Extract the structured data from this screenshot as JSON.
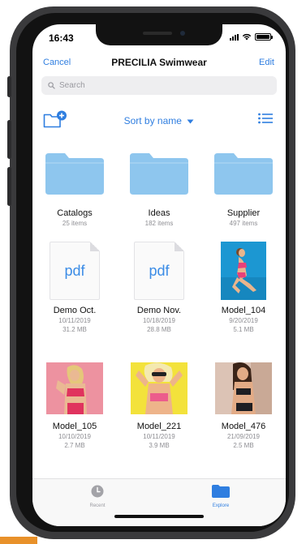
{
  "status": {
    "time": "16:43"
  },
  "nav": {
    "cancel": "Cancel",
    "title": "PRECILIA Swimwear",
    "edit": "Edit"
  },
  "search": {
    "placeholder": "Search",
    "value": ""
  },
  "toolbar": {
    "sort_label": "Sort by name",
    "new_folder_icon": "folder-plus-icon",
    "list_view_icon": "list-view-icon"
  },
  "items": [
    {
      "type": "folder",
      "name": "Catalogs",
      "meta1": "25 items",
      "meta2": ""
    },
    {
      "type": "folder",
      "name": "Ideas",
      "meta1": "182 items",
      "meta2": ""
    },
    {
      "type": "folder",
      "name": "Supplier",
      "meta1": "497 items",
      "meta2": ""
    },
    {
      "type": "pdf",
      "name": "Demo Oct.",
      "meta1": "10/11/2019",
      "meta2": "31.2 MB",
      "label": "pdf"
    },
    {
      "type": "pdf",
      "name": "Demo Nov.",
      "meta1": "10/18/2019",
      "meta2": "28.8 MB",
      "label": "pdf"
    },
    {
      "type": "photo",
      "name": "Model_104",
      "meta1": "9/20/2019",
      "meta2": "5.1 MB"
    },
    {
      "type": "photo",
      "name": "Model_105",
      "meta1": "10/10/2019",
      "meta2": "2.7 MB"
    },
    {
      "type": "photo",
      "name": "Model_221",
      "meta1": "10/11/2019",
      "meta2": "3.9 MB"
    },
    {
      "type": "photo",
      "name": "Model_476",
      "meta1": "21/09/2019",
      "meta2": "2.5 MB"
    }
  ],
  "tabs": [
    {
      "label": "Recent",
      "icon": "clock-icon",
      "active": false
    },
    {
      "label": "Explore",
      "icon": "folder-icon",
      "active": true
    }
  ],
  "colors": {
    "accent": "#2f7ee0",
    "folder": "#8ec6ee",
    "frame": "#3a3a3c"
  }
}
